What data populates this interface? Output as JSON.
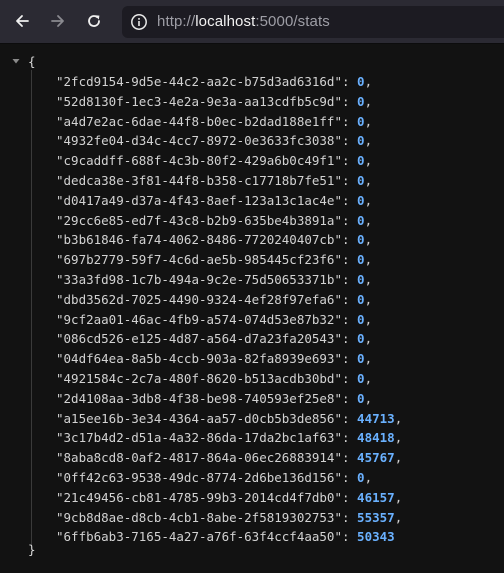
{
  "browser": {
    "url_prefix": "http://",
    "url_host": "localhost",
    "url_suffix": ":5000/stats"
  },
  "json_viewer": {
    "open_brace": "{",
    "close_brace": "}",
    "entries": [
      {
        "key": "\"2fcd9154-9d5e-44c2-aa2c-b75d3ad6316d\"",
        "value": "0"
      },
      {
        "key": "\"52d8130f-1ec3-4e2a-9e3a-aa13cdfb5c9d\"",
        "value": "0"
      },
      {
        "key": "\"a4d7e2ac-6dae-44f8-b0ec-b2dad188e1ff\"",
        "value": "0"
      },
      {
        "key": "\"4932fe04-d34c-4cc7-8972-0e3633fc3038\"",
        "value": "0"
      },
      {
        "key": "\"c9caddff-688f-4c3b-80f2-429a6b0c49f1\"",
        "value": "0"
      },
      {
        "key": "\"dedca38e-3f81-44f8-b358-c17718b7fe51\"",
        "value": "0"
      },
      {
        "key": "\"d0417a49-d37a-4f43-8aef-123a13c1ac4e\"",
        "value": "0"
      },
      {
        "key": "\"29cc6e85-ed7f-43c8-b2b9-635be4b3891a\"",
        "value": "0"
      },
      {
        "key": "\"b3b61846-fa74-4062-8486-7720240407cb\"",
        "value": "0"
      },
      {
        "key": "\"697b2779-59f7-4c6d-ae5b-985445cf23f6\"",
        "value": "0"
      },
      {
        "key": "\"33a3fd98-1c7b-494a-9c2e-75d50653371b\"",
        "value": "0"
      },
      {
        "key": "\"dbd3562d-7025-4490-9324-4ef28f97efa6\"",
        "value": "0"
      },
      {
        "key": "\"9cf2aa01-46ac-4fb9-a574-074d53e87b32\"",
        "value": "0"
      },
      {
        "key": "\"086cd526-e125-4d87-a564-d7a23fa20543\"",
        "value": "0"
      },
      {
        "key": "\"04df64ea-8a5b-4ccb-903a-82fa8939e693\"",
        "value": "0"
      },
      {
        "key": "\"4921584c-2c7a-480f-8620-b513acdb30bd\"",
        "value": "0"
      },
      {
        "key": "\"2d4108aa-3db8-4f38-be98-740593ef25e8\"",
        "value": "0"
      },
      {
        "key": "\"a15ee16b-3e34-4364-aa57-d0cb5b3de856\"",
        "value": "44713"
      },
      {
        "key": "\"3c17b4d2-d51a-4a32-86da-17da2bc1af63\"",
        "value": "48418"
      },
      {
        "key": "\"8aba8cd8-0af2-4817-864a-06ec26883914\"",
        "value": "45767"
      },
      {
        "key": "\"0ff42c63-9538-49dc-8774-2d6be136d156\"",
        "value": "0"
      },
      {
        "key": "\"21c49456-cb81-4785-99b3-2014cd4f7db0\"",
        "value": "46157"
      },
      {
        "key": "\"9cb8d8ae-d8cb-4cb1-8abe-2f5819302753\"",
        "value": "55357"
      },
      {
        "key": "\"6ffb6ab3-7165-4a27-a76f-63f4ccf4aa50\"",
        "value": "50343"
      }
    ]
  }
}
